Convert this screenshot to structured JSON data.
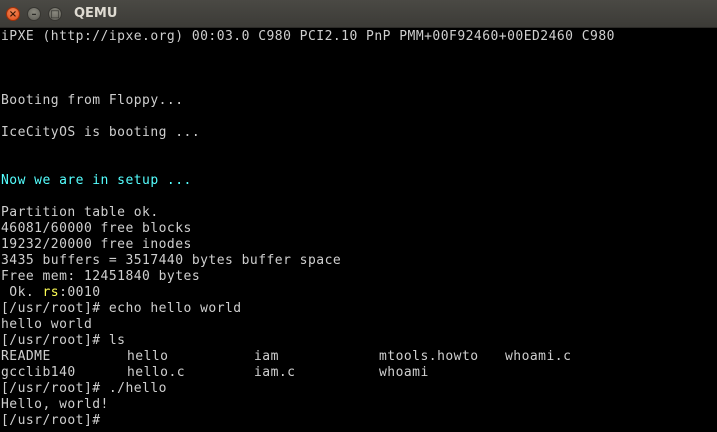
{
  "window": {
    "title": "QEMU",
    "close_glyph": "×",
    "minimize_glyph": "–",
    "maximize_glyph": "□"
  },
  "console": {
    "ipxe_line": "iPXE (http://ipxe.org) 00:03.0 C980 PCI2.10 PnP PMM+00F92460+00ED2460 C980",
    "booting_floppy": "Booting from Floppy...",
    "os_booting": "IceCityOS is booting ...",
    "setup_line": "Now we are in setup ...",
    "partition": "Partition table ok.",
    "free_blocks": "46081/60000 free blocks",
    "free_inodes": "19232/20000 free inodes",
    "buffers": "3435 buffers = 3517440 bytes buffer space",
    "free_mem": "Free mem: 12451840 bytes",
    "ok_prefix": " Ok. ",
    "rs_label": "rs",
    "rs_value": ":0010",
    "cmd_echo": "[/usr/root]# echo hello world",
    "echo_output": "hello world",
    "cmd_ls": "[/usr/root]# ls",
    "ls_files": [
      "README",
      "hello",
      "iam",
      "mtools.howto",
      "whoami.c",
      "gcclib140",
      "hello.c",
      "iam.c",
      "whoami"
    ],
    "cmd_hello": "[/usr/root]# ./hello",
    "hello_output": "Hello, world!",
    "prompt": "[/usr/root]#"
  }
}
